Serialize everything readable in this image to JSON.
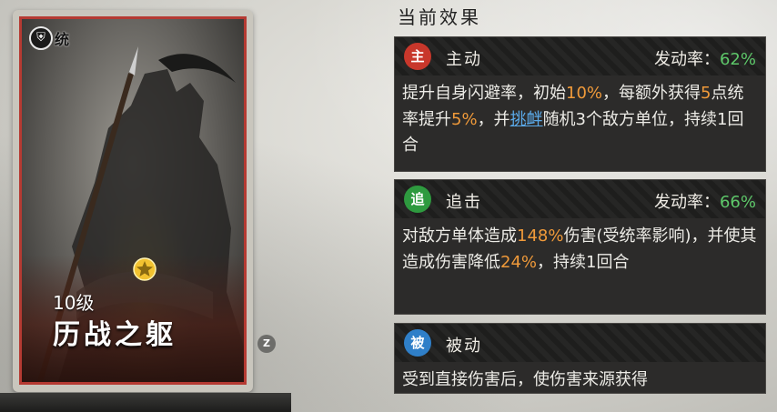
{
  "card": {
    "troop_label": "统",
    "level": "10级",
    "name": "历战之躯",
    "hotkey": "Z"
  },
  "panel": {
    "title": "当前效果",
    "effects": [
      {
        "icon_char": "主",
        "icon_color": "#c8372b",
        "type": "主动",
        "rate_label": "发动率：",
        "rate_value": "62%",
        "desc": {
          "p1": "提升自身闪避率，初始",
          "h1": "10%",
          "p2": "，每额外获得",
          "h2": "5",
          "p3": "点统率提升",
          "h3": "5%",
          "p4": "，并",
          "link": "挑衅",
          "p5": "随机3个敌方单位，持续1回合"
        }
      },
      {
        "icon_char": "追",
        "icon_color": "#2e9a3f",
        "type": "追击",
        "rate_label": "发动率：",
        "rate_value": "66%",
        "desc": {
          "p1": "对敌方单体造成",
          "h1": "148%",
          "p2": "伤害(受统率影响)，并使其造成伤害降低",
          "h2": "24%",
          "p3": "，持续1回合"
        }
      },
      {
        "icon_char": "被",
        "icon_color": "#2f7fc8",
        "type": "被动",
        "desc": {
          "p1": "受到直接伤害后，使伤害来源获得"
        }
      }
    ]
  },
  "colors": {
    "card_border": "#b53a32",
    "rate_green": "#5ec86a",
    "highlight_orange": "#f09a3a",
    "link_blue": "#5aa9e8"
  }
}
